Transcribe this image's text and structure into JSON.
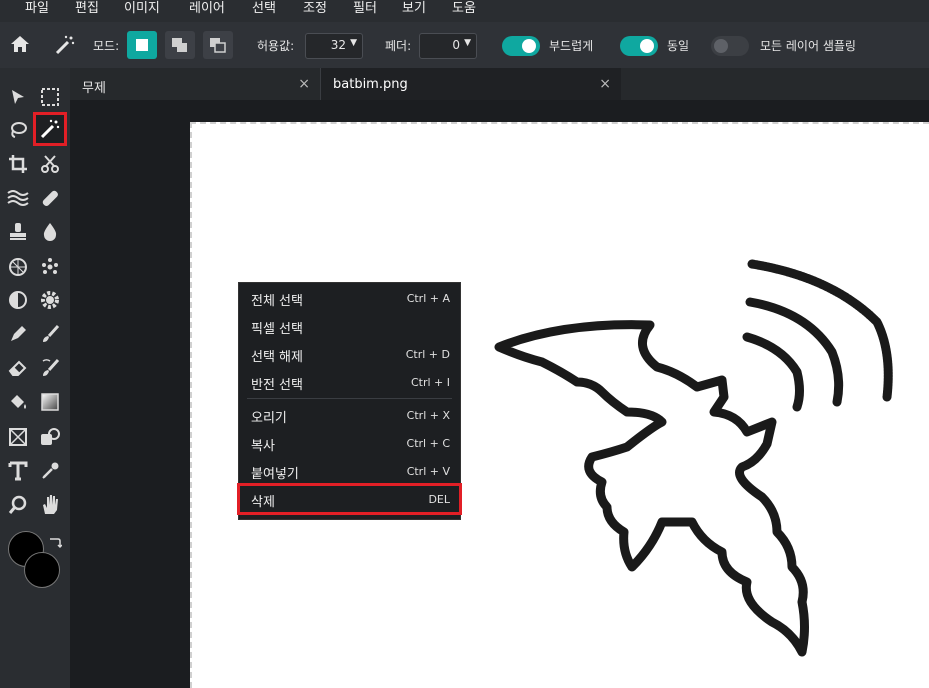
{
  "menubar": [
    "파일",
    "편집",
    "이미지",
    "레이어",
    "선택",
    "조정",
    "필터",
    "보기",
    "도움"
  ],
  "toolbar": {
    "mode_label": "모드:",
    "tolerance_label": "허용값:",
    "tolerance_value": "32",
    "feather_label": "페더:",
    "feather_value": "0",
    "smooth_label": "부드럽게",
    "smooth_on": true,
    "contiguous_label": "동일",
    "contiguous_on": true,
    "sample_all_label": "모든 레이어 샘플링",
    "sample_all_on": false
  },
  "tabs": [
    {
      "label": "무제",
      "close": "×",
      "active": false
    },
    {
      "label": "batbim.png",
      "close": "×",
      "active": true
    }
  ],
  "context_menu": {
    "items": [
      {
        "label": "전체 선택",
        "shortcut": "Ctrl + A"
      },
      {
        "label": "픽셀 선택",
        "shortcut": ""
      },
      {
        "label": "선택 해제",
        "shortcut": "Ctrl + D"
      },
      {
        "label": "반전 선택",
        "shortcut": "Ctrl + I"
      },
      {
        "label": "오리기",
        "shortcut": "Ctrl + X"
      },
      {
        "label": "복사",
        "shortcut": "Ctrl + C"
      },
      {
        "label": "붙여넣기",
        "shortcut": "Ctrl + V"
      },
      {
        "label": "삭제",
        "shortcut": "DEL"
      }
    ]
  },
  "colors": {
    "accent": "#0fa8a0",
    "highlight": "#e21f26",
    "foreground": "#000000",
    "background": "#000000"
  }
}
